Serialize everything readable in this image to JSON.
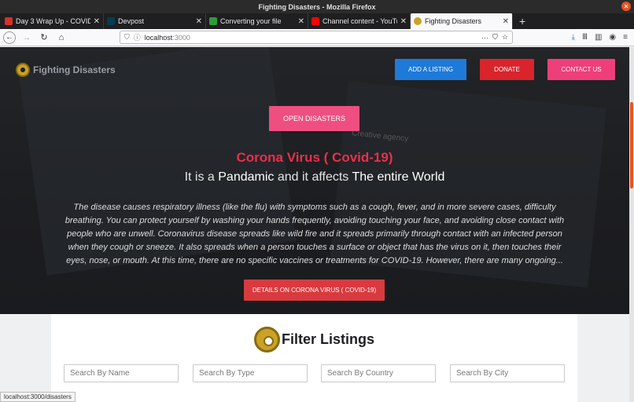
{
  "window": {
    "title": "Fighting Disasters - Mozilla Firefox"
  },
  "tabs": [
    {
      "label": "Day 3 Wrap Up - COVID-",
      "favicon_color": "#d93025"
    },
    {
      "label": "Devpost",
      "favicon_color": "#003e54"
    },
    {
      "label": "Converting your file",
      "favicon_color": "#2e9c3a"
    },
    {
      "label": "Channel content - YouTu",
      "favicon_color": "#ff0000"
    },
    {
      "label": "Fighting Disasters",
      "favicon_color": "#c9a227"
    }
  ],
  "address": {
    "host": "localhost",
    "port": ":3000"
  },
  "status_url": "localhost:3000/disasters",
  "brand": {
    "name": "Fighting Disasters"
  },
  "nav": {
    "add_listing": "ADD A LISTING",
    "donate": "DONATE",
    "contact": "CONTACT US"
  },
  "hero": {
    "open_button": "OPEN DISASTERS",
    "bg_text": "Creative agency",
    "title": "Corona Virus ( Covid-19)",
    "sub_pre": "It is a",
    "sub_b1": "Pandamic",
    "sub_mid": "and it affects",
    "sub_b2": "The entire World",
    "description": "The disease causes respiratory illness (like the flu) with symptoms such as a cough, fever, and in more severe cases, difficulty breathing. You can protect yourself by washing your hands frequently, avoiding touching your face, and avoiding close contact with people who are unwell. Coronavirus disease spreads like wild fire and it spreads primarily through contact with an infected person when they cough or sneeze. It also spreads when a person touches a surface or object that has the virus on it, then touches their eyes, nose, or mouth. At this time, there are no specific vaccines or treatments for COVID-19. However, there are many ongoing...",
    "details_button": "DETAILS ON CORONA VIRUS ( COVID-19)"
  },
  "filter": {
    "title": "Filter Listings",
    "name_placeholder": "Search By Name",
    "type_placeholder": "Search By Type",
    "country_placeholder": "Search By Country",
    "city_placeholder": "Search By City"
  },
  "colors": {
    "accent": "#e95420",
    "add_button": "#1e7ad8",
    "donate_button": "#d9242c",
    "contact_button": "#ee3f7a",
    "title_red": "#e8304a"
  }
}
